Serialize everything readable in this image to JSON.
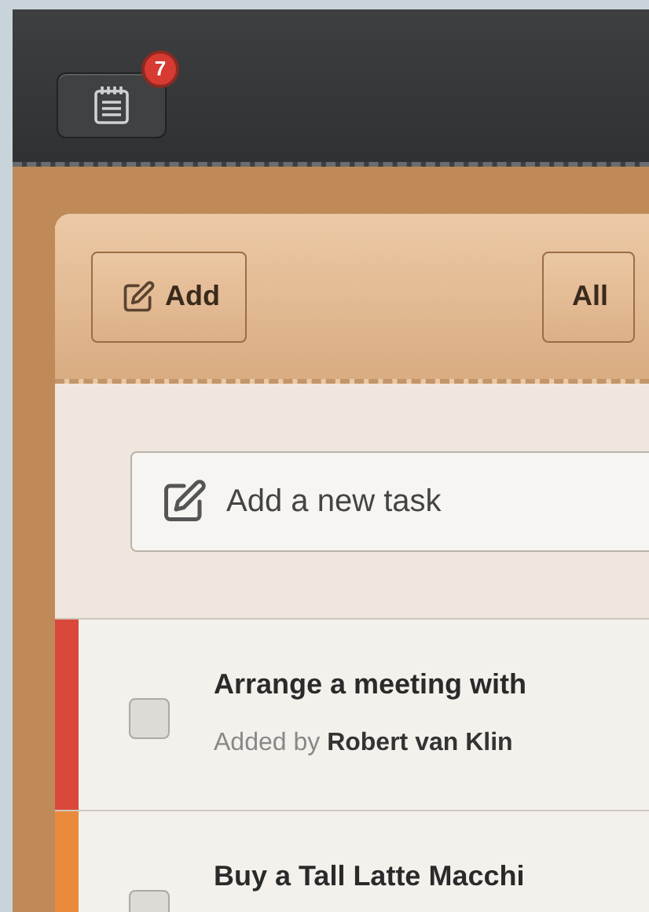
{
  "top_bar": {
    "notes_button": {
      "badge": "7"
    }
  },
  "toolbar": {
    "buttons": [
      {
        "kind": "add",
        "label": "Add"
      },
      {
        "kind": "filter",
        "label": "All"
      }
    ]
  },
  "new_task": {
    "placeholder": "Add a new task"
  },
  "tasks": [
    {
      "title": "Arrange a meeting with",
      "subtitle": "Added by **Robert van Klin**",
      "checked": false,
      "color": "#d9483b"
    },
    {
      "title": "Buy a Tall Latte Macchi",
      "checked": false,
      "color": "#ea8a3c"
    }
  ]
}
